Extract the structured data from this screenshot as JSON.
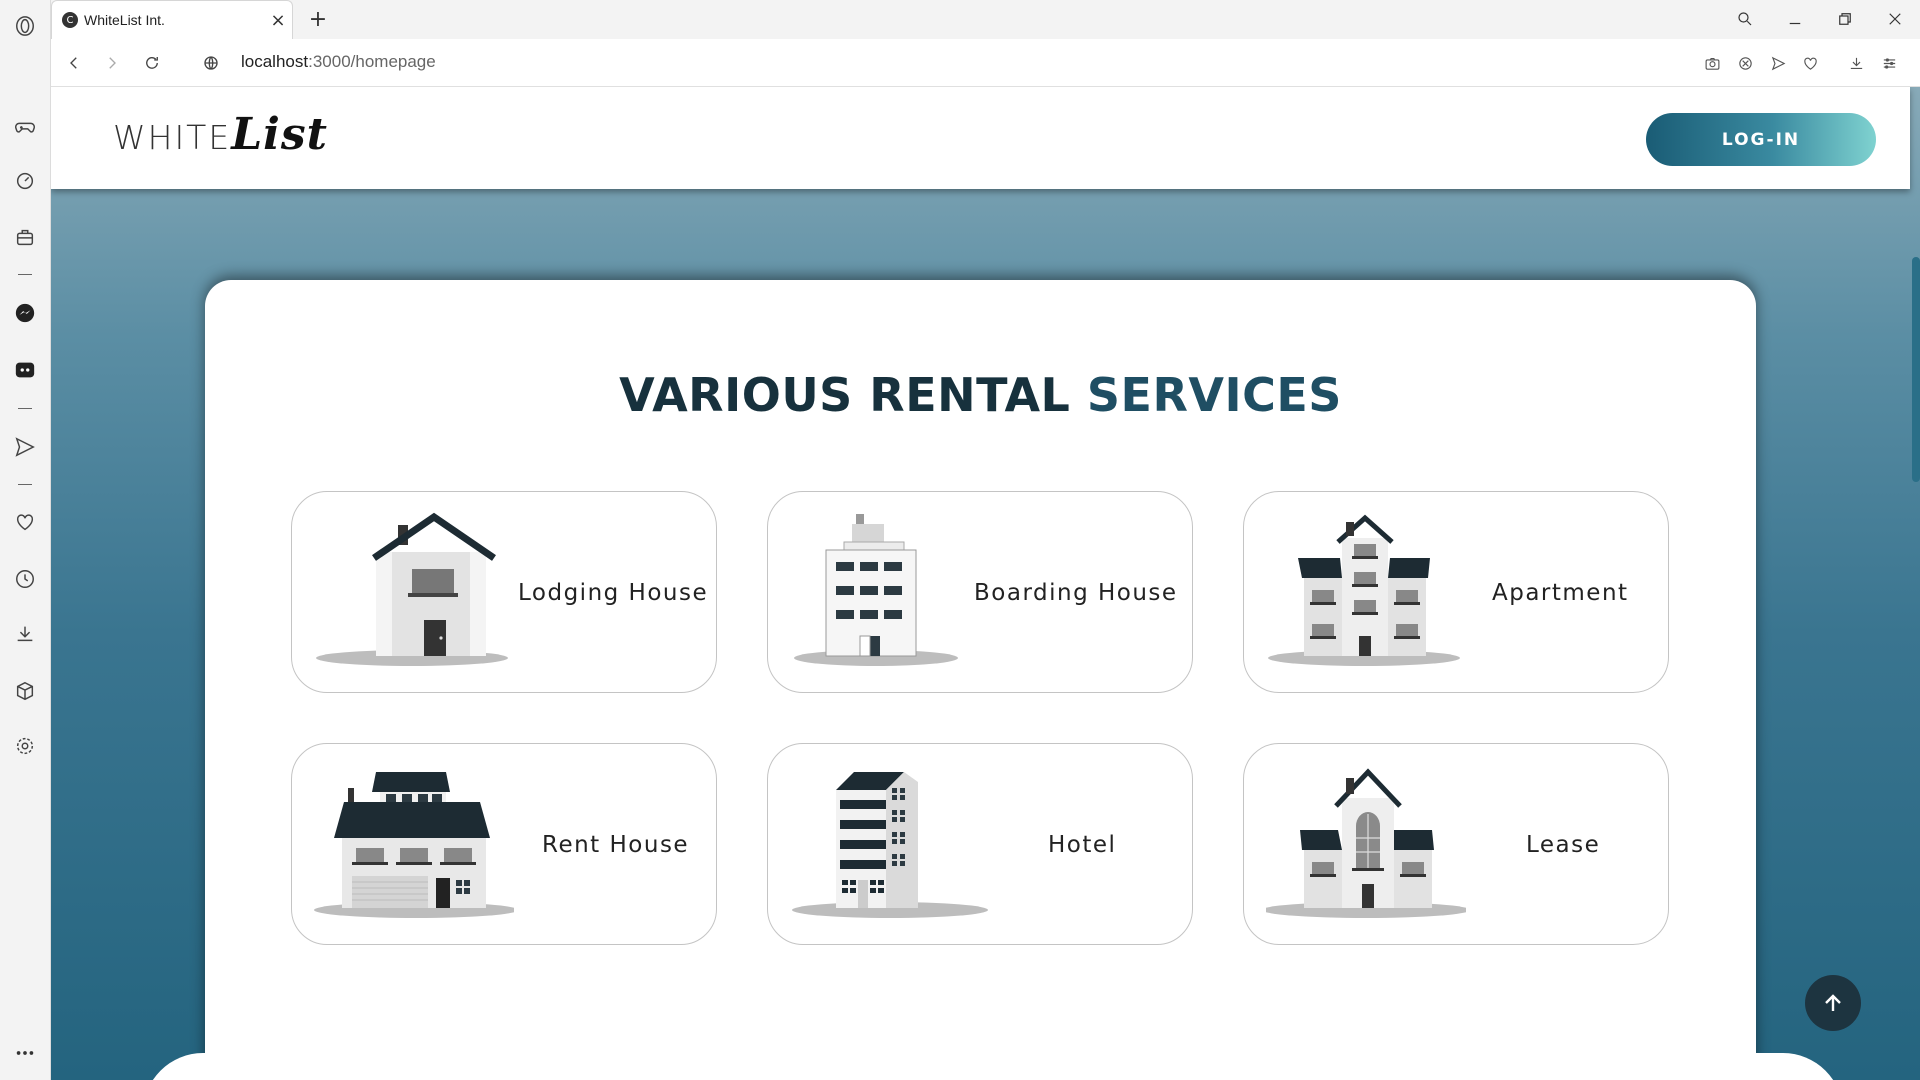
{
  "browser": {
    "tab_title": "WhiteList Int.",
    "tab_favicon": "C",
    "url_host": "localhost",
    "url_path": ":3000/homepage",
    "sidebar_icons": [
      "opera-icon",
      "gamepad-icon",
      "speed-dial-icon",
      "bag-icon",
      "messenger-icon",
      "discord-icon",
      "send-icon",
      "heart-icon",
      "history-icon",
      "download-icon",
      "cube-icon",
      "settings-icon",
      "more-icon"
    ]
  },
  "site": {
    "logo_white": "WHITE",
    "logo_list": "List",
    "login_label": "LOG-IN"
  },
  "services": {
    "title_part1": "VARIOUS RENTAL ",
    "title_part2": "SERVICES",
    "items": [
      {
        "label": "Lodging House"
      },
      {
        "label": "Boarding House"
      },
      {
        "label": "Apartment"
      },
      {
        "label": "Rent House"
      },
      {
        "label": "Hotel"
      },
      {
        "label": "Lease"
      }
    ]
  },
  "colors": {
    "title": "#17313d",
    "login_gradient_start": "#1a5c75",
    "login_gradient_end": "#7fd2d0",
    "background_top": "#88aab8",
    "background_bottom": "#24647f",
    "scroll_top_button": "#1d3440"
  }
}
